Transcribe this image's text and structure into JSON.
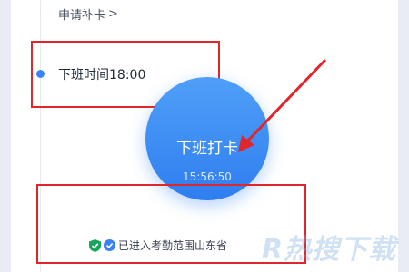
{
  "header": {
    "reissue_label": "申请补卡"
  },
  "timeline": {
    "offwork_label": "下班时间18:00"
  },
  "punch": {
    "label": "下班打卡",
    "time": "15:56:50"
  },
  "status": {
    "text": "已进入考勤范围山东省"
  },
  "watermark": {
    "text": "R热搜下载"
  },
  "colors": {
    "accent": "#2f7ef0",
    "annotation": "#e0262a",
    "shield": "#1aa35b"
  }
}
